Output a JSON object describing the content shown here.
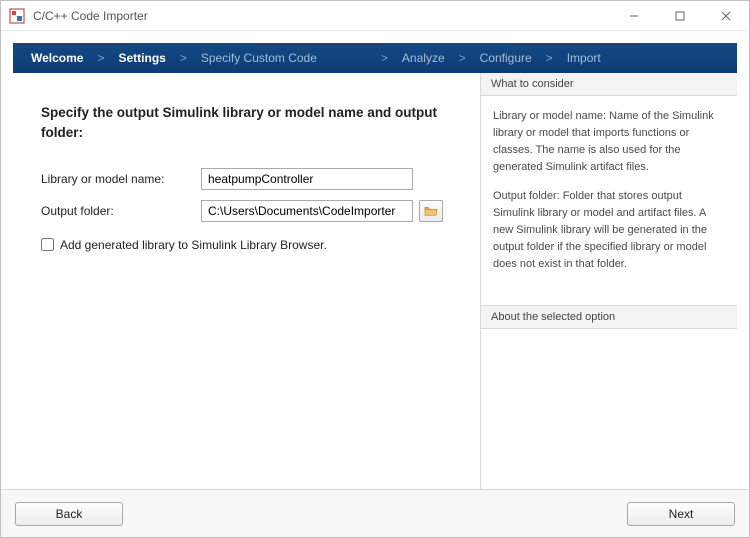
{
  "window": {
    "title": "C/C++ Code Importer"
  },
  "nav": {
    "steps": {
      "welcome": "Welcome",
      "settings": "Settings",
      "specify": "Specify Custom Code",
      "analyze": "Analyze",
      "configure": "Configure",
      "import": "Import"
    },
    "sep": ">"
  },
  "main": {
    "heading": "Specify the output Simulink library or model name and output folder:",
    "labels": {
      "library_name": "Library or model name:",
      "output_folder": "Output folder:"
    },
    "values": {
      "library_name": "heatpumpController",
      "output_folder": "C:\\Users\\Documents\\CodeImporter"
    },
    "checkbox": {
      "add_to_browser": "Add generated library to Simulink Library Browser."
    }
  },
  "sidebar": {
    "what_header": "What to consider",
    "what_body_p1": "Library or model name: Name of the Simulink library or model that imports functions or classes. The name is also used for the generated Simulink artifact files.",
    "what_body_p2": "Output folder: Folder that stores output Simulink library or model and artifact files. A new Simulink library will be generated in the output folder if the specified library or model does not exist in that folder.",
    "about_header": "About the selected option"
  },
  "footer": {
    "back": "Back",
    "next": "Next"
  }
}
